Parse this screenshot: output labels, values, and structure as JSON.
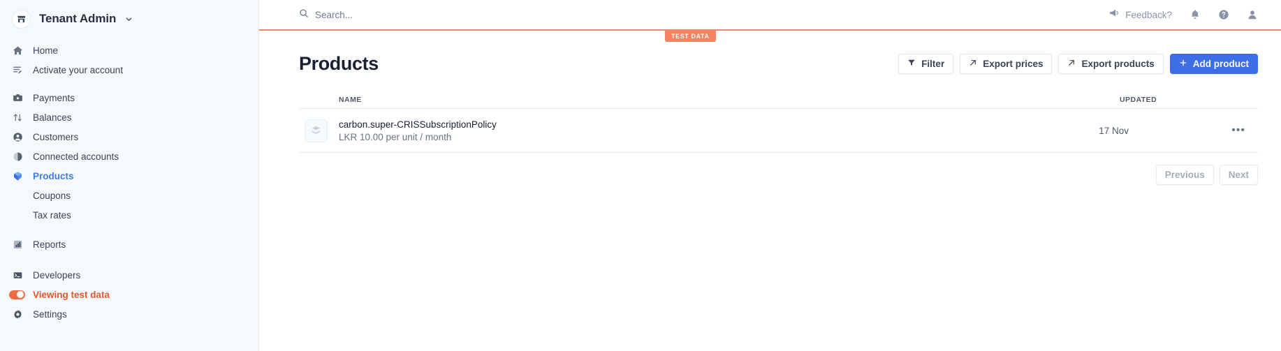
{
  "sidebar": {
    "tenant": {
      "name": "Tenant Admin",
      "avatar_icon": "store-icon",
      "chevron_icon": "chevron-down-icon"
    },
    "groups": [
      {
        "items": [
          {
            "label": "Home",
            "icon": "home-icon",
            "active": false
          },
          {
            "label": "Activate your account",
            "icon": "activate-account-icon",
            "active": false
          }
        ]
      },
      {
        "items": [
          {
            "label": "Payments",
            "icon": "payments-icon",
            "active": false
          },
          {
            "label": "Balances",
            "icon": "balances-icon",
            "active": false
          },
          {
            "label": "Customers",
            "icon": "customers-icon",
            "active": false
          },
          {
            "label": "Connected accounts",
            "icon": "connected-accounts-icon",
            "active": false
          },
          {
            "label": "Products",
            "icon": "products-icon",
            "active": true
          },
          {
            "label": "Coupons",
            "icon": "",
            "active": false,
            "sub": true
          },
          {
            "label": "Tax rates",
            "icon": "",
            "active": false,
            "sub": true
          },
          {
            "label": "Reports",
            "icon": "reports-icon",
            "active": false
          }
        ]
      },
      {
        "items": [
          {
            "label": "Developers",
            "icon": "developers-icon",
            "active": false
          },
          {
            "label": "Viewing test data",
            "icon": "toggle-on-icon",
            "active": false
          },
          {
            "label": "Settings",
            "icon": "gear-icon",
            "active": false
          }
        ]
      }
    ]
  },
  "topbar": {
    "search": {
      "placeholder": "Search...",
      "value": "",
      "icon": "search-icon"
    },
    "feedback": {
      "label": "Feedback?",
      "icon": "megaphone-icon"
    },
    "icons": [
      {
        "name": "notifications-bell-icon"
      },
      {
        "name": "help-question-icon"
      },
      {
        "name": "user-account-icon"
      }
    ]
  },
  "test_badge": {
    "label": "TEST DATA"
  },
  "page": {
    "title": "Products",
    "actions": [
      {
        "label": "Filter",
        "icon": "filter-icon",
        "primary": false
      },
      {
        "label": "Export prices",
        "icon": "external-link-icon",
        "primary": false
      },
      {
        "label": "Export products",
        "icon": "external-link-icon",
        "primary": false
      },
      {
        "label": "Add product",
        "icon": "plus-icon",
        "primary": true
      }
    ]
  },
  "table": {
    "columns": {
      "name": "NAME",
      "updated": "UPDATED"
    },
    "rows": [
      {
        "icon": "product-box-icon",
        "name": "carbon.super-CRISSubscriptionPolicy",
        "price": "LKR 10.00 per unit / month",
        "updated": "17 Nov",
        "menu_icon": "overflow-menu-icon"
      }
    ]
  },
  "pagination": {
    "previous": "Previous",
    "next": "Next"
  },
  "colors": {
    "accent_blue": "#3d6ee3",
    "test_orange": "#f4815f",
    "testdata_red": "#e8552e",
    "sidebar_bg": "#f6f9fc",
    "text_dark": "#1a1f36"
  }
}
